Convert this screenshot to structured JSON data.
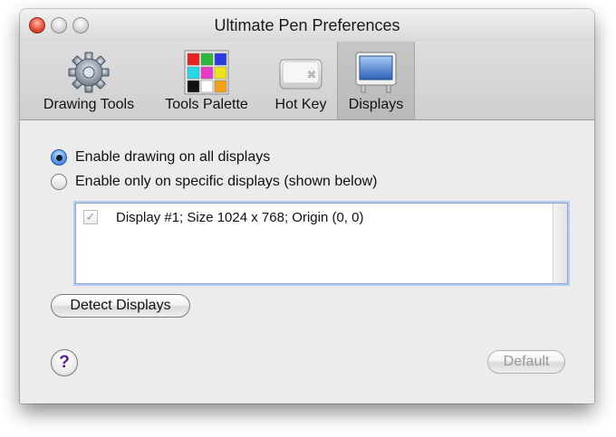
{
  "window": {
    "title": "Ultimate Pen Preferences"
  },
  "toolbar": {
    "items": [
      {
        "label": "Drawing Tools",
        "icon": "gear-icon"
      },
      {
        "label": "Tools Palette",
        "icon": "color-palette-icon"
      },
      {
        "label": "Hot Key",
        "icon": "keyboard-key-icon"
      },
      {
        "label": "Displays",
        "icon": "display-monitor-icon",
        "selected": true
      }
    ],
    "palette_colors": [
      "#e8231f",
      "#2db83a",
      "#2a3be0",
      "#28d6e6",
      "#e63bc8",
      "#f2e21e",
      "#111111",
      "#ffffff",
      "#f4a11a"
    ]
  },
  "options": {
    "all_displays_label": "Enable drawing on all displays",
    "specific_displays_label": "Enable only on specific displays (shown below)",
    "selected": "all"
  },
  "displays_list": {
    "items": [
      {
        "label": "Display #1; Size 1024 x 768; Origin (0, 0)",
        "checked": true
      }
    ]
  },
  "buttons": {
    "detect": "Detect Displays",
    "default": "Default",
    "help": "?"
  }
}
